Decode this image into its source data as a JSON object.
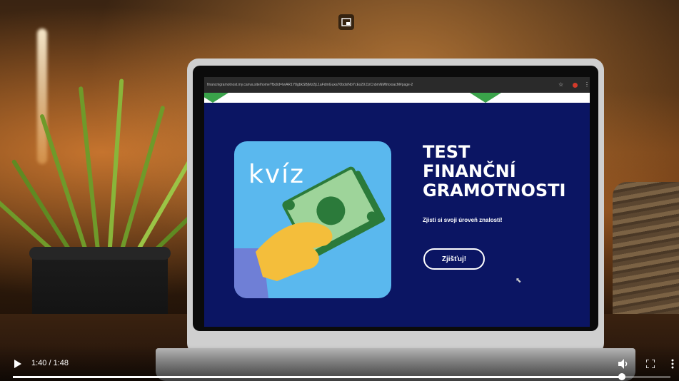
{
  "video": {
    "current_time": "1:40",
    "duration": "1:48",
    "time_separator": " / ",
    "progress_fraction": 0.926
  },
  "browser": {
    "url": "financnigramotnost.my.canva.site/home?fbclid=IwAR1Y8gbkSBjMz2jL1aFdmGuxa70bdxiNbYcEs29.DzCnbmNMfmxoacM#page-2"
  },
  "page": {
    "quiz_word": "kvíz",
    "title_lines": [
      "TEST",
      "FINANČNÍ",
      "GRAMOTNOSTI"
    ],
    "subtitle": "Zjisti si svoji úroveň znalostí!",
    "cta_label": "Zjišťuj!"
  },
  "colors": {
    "page_background": "#0b1563",
    "card_background": "#5ab8ee",
    "accent_green": "#3aa34a"
  }
}
